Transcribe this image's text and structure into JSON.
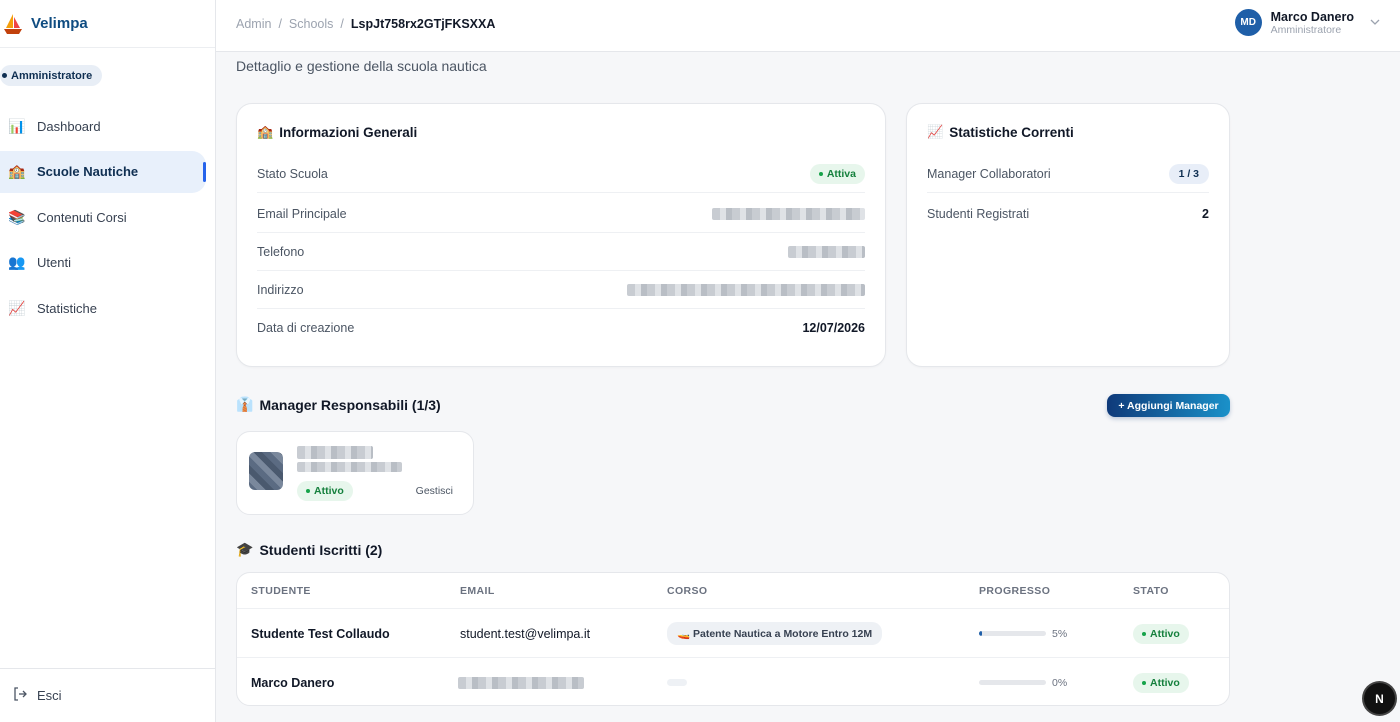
{
  "app": {
    "name": "Velimpa"
  },
  "sidebar": {
    "role": "Amministratore",
    "items": [
      {
        "label": "Dashboard",
        "icon": "📊"
      },
      {
        "label": "Scuole Nautiche",
        "icon": "🏫"
      },
      {
        "label": "Contenuti Corsi",
        "icon": "📚"
      },
      {
        "label": "Utenti",
        "icon": "👥"
      },
      {
        "label": "Statistiche",
        "icon": "📈"
      }
    ],
    "logout": "Esci"
  },
  "header": {
    "breadcrumb": [
      "Admin",
      "Schools",
      "LspJt758rx2GTjFKSXXA"
    ],
    "user": {
      "initials": "MD",
      "name": "Marco Danero",
      "role": "Amministratore"
    }
  },
  "page": {
    "subtitle": "Dettaglio e gestione della scuola nautica"
  },
  "info_card": {
    "title": "Informazioni Generali",
    "icon": "🏫",
    "rows": [
      {
        "label": "Stato Scuola",
        "value": "Attiva"
      },
      {
        "label": "Email Principale",
        "value": ""
      },
      {
        "label": "Telefono",
        "value": ""
      },
      {
        "label": "Indirizzo",
        "value": ""
      },
      {
        "label": "Data di creazione",
        "value": "12/07/2026"
      }
    ]
  },
  "stats_card": {
    "title": "Statistiche Correnti",
    "icon": "📈",
    "rows": [
      {
        "label": "Manager Collaboratori",
        "value": "1 / 3"
      },
      {
        "label": "Studenti Registrati",
        "value": "2"
      }
    ]
  },
  "managers": {
    "title": "Manager Responsabili (1/3)",
    "icon": "👔",
    "add_button": "+ Aggiungi Manager",
    "items": [
      {
        "status": "Attivo",
        "action": "Gestisci"
      }
    ]
  },
  "students": {
    "title": "Studenti Iscritti (2)",
    "icon": "🎓",
    "columns": [
      "STUDENTE",
      "EMAIL",
      "CORSO",
      "PROGRESSO",
      "STATO"
    ],
    "rows": [
      {
        "name": "Studente Test Collaudo",
        "email": "student.test@velimpa.it",
        "course": "🚤 Patente Nautica a Motore Entro 12M",
        "progress": 5,
        "progress_label": "5%",
        "status": "Attivo"
      },
      {
        "name": "Marco Danero",
        "email": "",
        "course": "",
        "progress": 0,
        "progress_label": "0%",
        "status": "Attivo"
      }
    ]
  },
  "fab": {
    "label": "N"
  }
}
